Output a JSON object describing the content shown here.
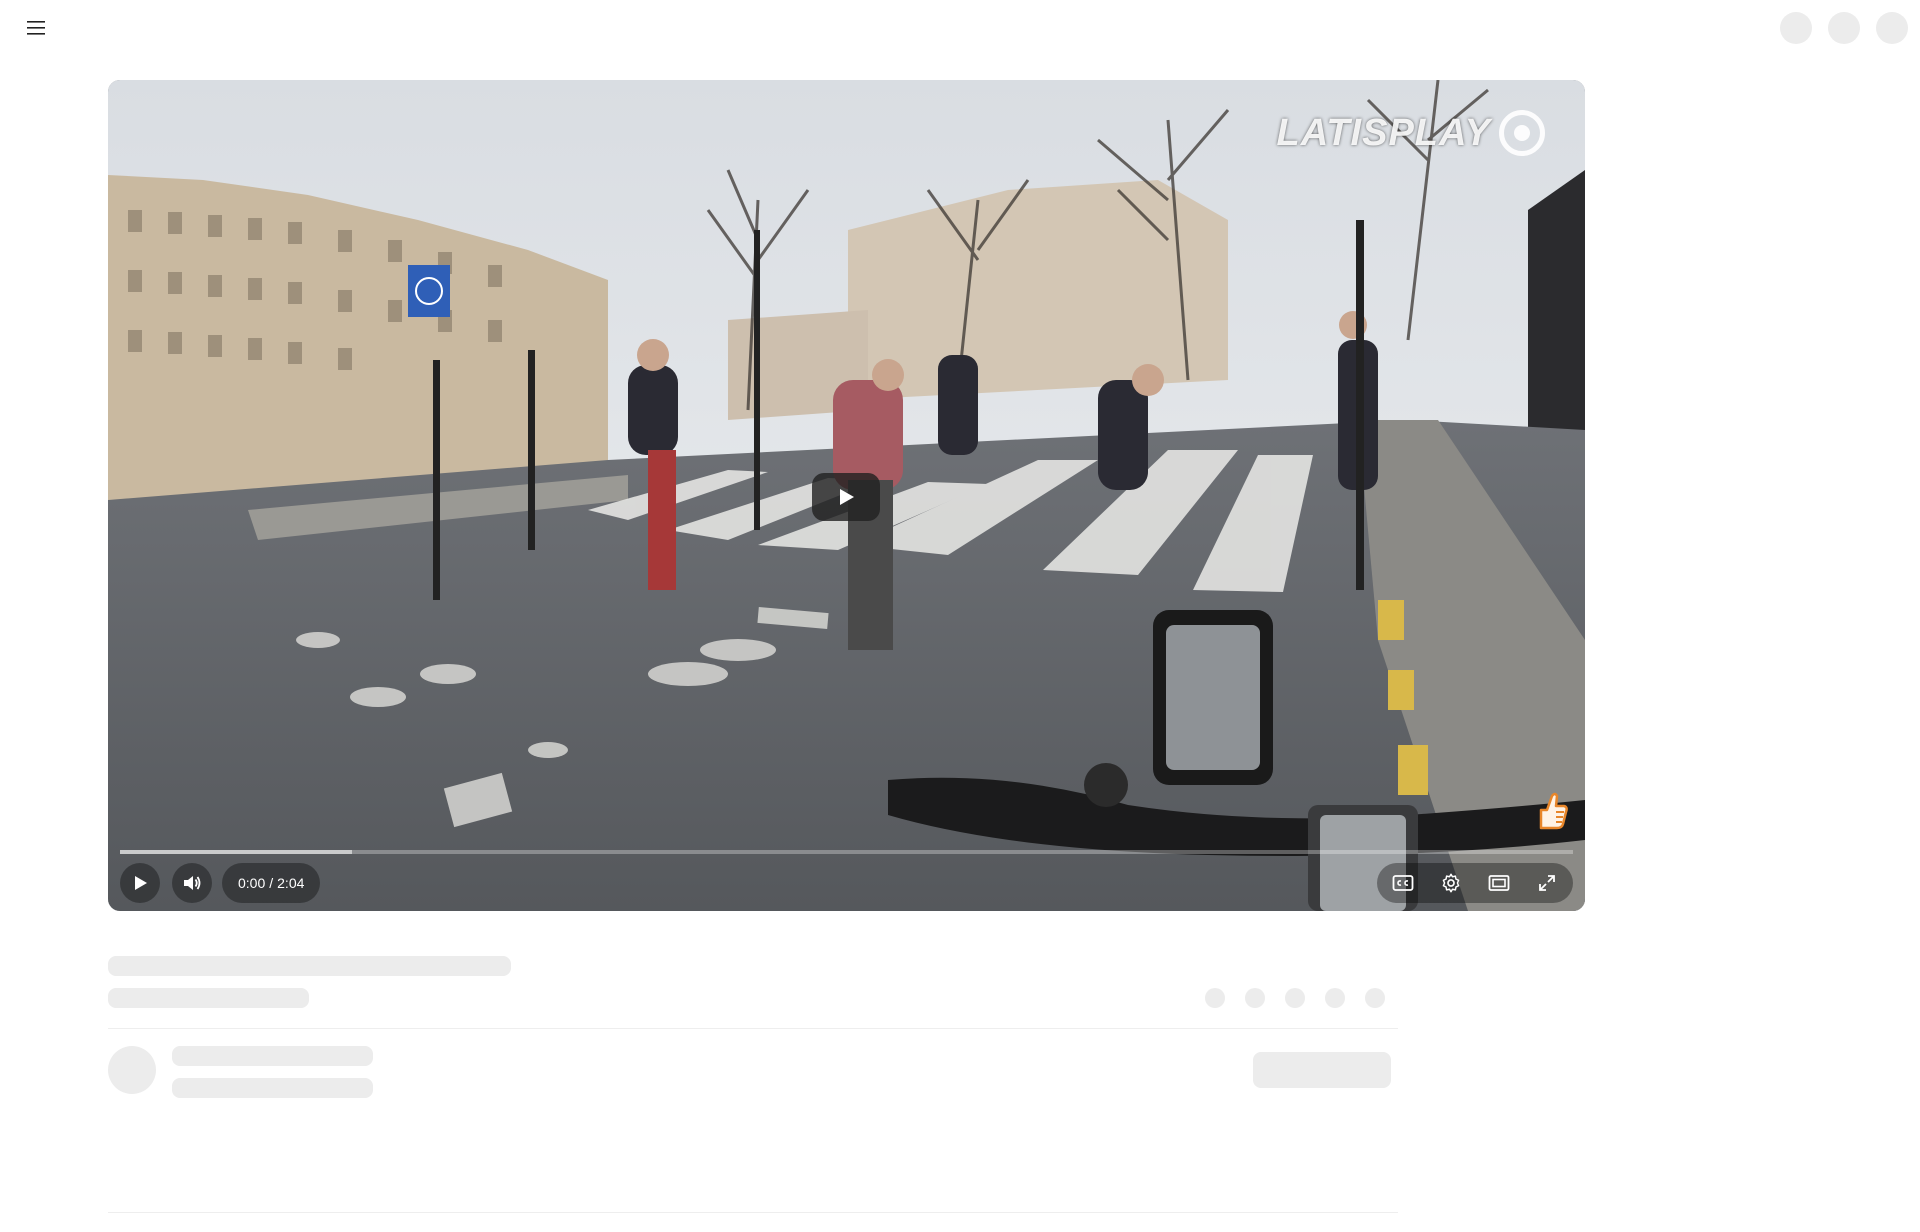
{
  "header": {
    "menu_icon": "hamburger-menu-icon"
  },
  "player": {
    "watermark_text": "LATISPLAY",
    "time_current": "0:00",
    "time_separator": "/",
    "time_total": "2:04",
    "progress_played_fraction": 0,
    "buffer_loaded_fraction": 0.16,
    "icons": {
      "center": "play-icon",
      "play": "play-icon",
      "volume": "volume-icon",
      "captions": "closed-captions-icon",
      "settings": "gear-icon",
      "theater": "theater-mode-icon",
      "fullscreen": "fullscreen-icon",
      "badge": "thumbs-up-icon"
    }
  },
  "colors": {
    "skeleton": "#ececec",
    "control_bg": "rgba(0,0,0,0.35)",
    "badge_accent": "#e8862a"
  }
}
